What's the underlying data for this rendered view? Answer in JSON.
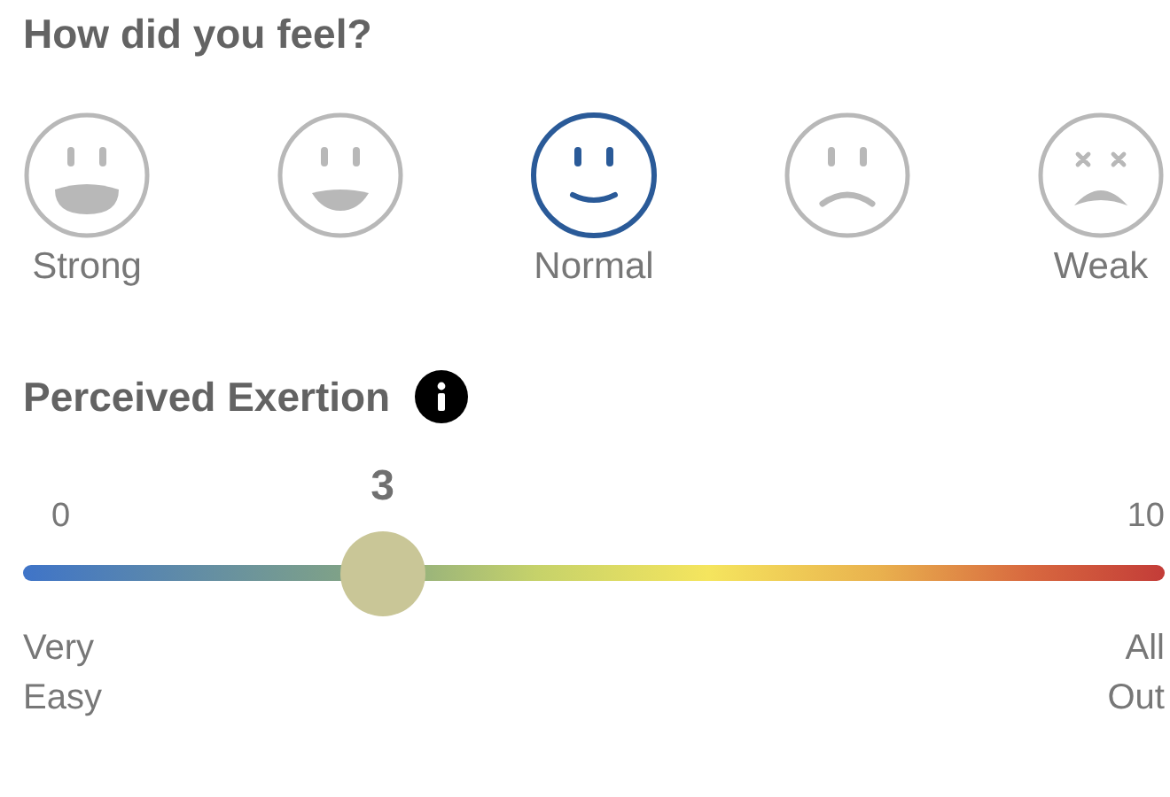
{
  "feeling": {
    "title": "How did you feel?",
    "faces": [
      {
        "kind": "grin",
        "label": "Strong",
        "selected": false
      },
      {
        "kind": "smile",
        "selected": false
      },
      {
        "kind": "neutral",
        "label": "Normal",
        "selected": true
      },
      {
        "kind": "frown",
        "selected": false
      },
      {
        "kind": "dizzy",
        "label": "Weak",
        "selected": false
      }
    ]
  },
  "exertion": {
    "title": "Perceived Exertion",
    "min_label": "0",
    "max_label": "10",
    "value": "3",
    "level": 0.315,
    "low_caption": "Very\nEasy",
    "high_caption": "All\nOut"
  }
}
